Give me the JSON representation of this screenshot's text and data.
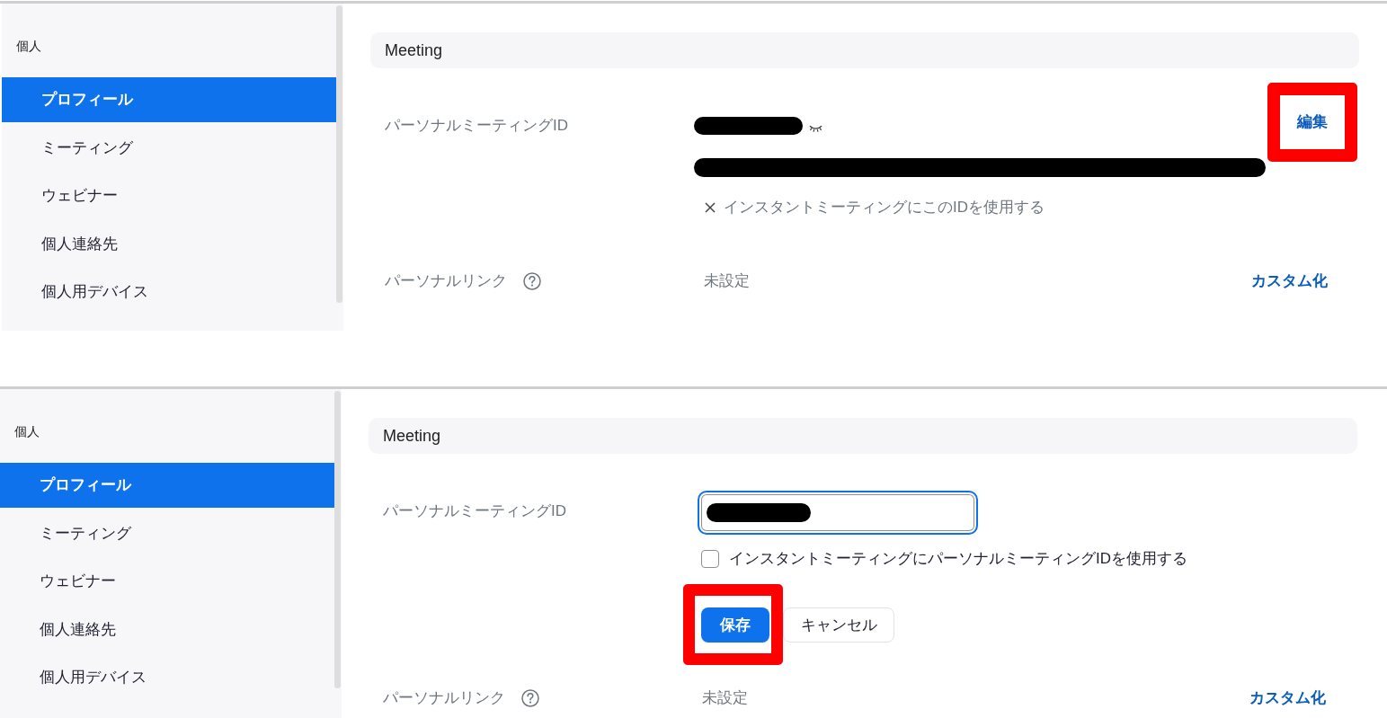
{
  "screens": [
    {
      "kind": "view",
      "sidebar": {
        "heading": "個人",
        "items": [
          {
            "label": "プロフィール",
            "selected": true
          },
          {
            "label": "ミーティング",
            "selected": false
          },
          {
            "label": "ウェビナー",
            "selected": false
          },
          {
            "label": "個人連絡先",
            "selected": false
          },
          {
            "label": "個人用デバイス",
            "selected": false
          }
        ]
      },
      "section_title": "Meeting",
      "personal_meeting_id": {
        "label": "パーソナルミーティングID",
        "instant_option": {
          "label": "インスタントミーティングにこのIDを使用する",
          "enabled": false
        },
        "edit_link": {
          "label": "編集",
          "highlighted": true
        }
      },
      "personal_link": {
        "label": "パーソナルリンク",
        "value": "未設定",
        "action": "カスタム化"
      }
    },
    {
      "kind": "edit",
      "sidebar": {
        "heading": "個人",
        "items": [
          {
            "label": "プロフィール",
            "selected": true
          },
          {
            "label": "ミーティング",
            "selected": false
          },
          {
            "label": "ウェビナー",
            "selected": false
          },
          {
            "label": "個人連絡先",
            "selected": false
          },
          {
            "label": "個人用デバイス",
            "selected": false
          }
        ]
      },
      "section_title": "Meeting",
      "personal_meeting_id": {
        "label": "パーソナルミーティングID",
        "instant_option": {
          "label": "インスタントミーティングにパーソナルミーティングIDを使用する",
          "checked": false
        },
        "buttons": [
          {
            "label": "保存",
            "kind": "primary",
            "highlighted": true
          },
          {
            "label": "キャンセル",
            "kind": "secondary",
            "highlighted": false
          }
        ]
      },
      "personal_link": {
        "label": "パーソナルリンク",
        "value": "未設定",
        "action": "カスタム化"
      }
    }
  ]
}
